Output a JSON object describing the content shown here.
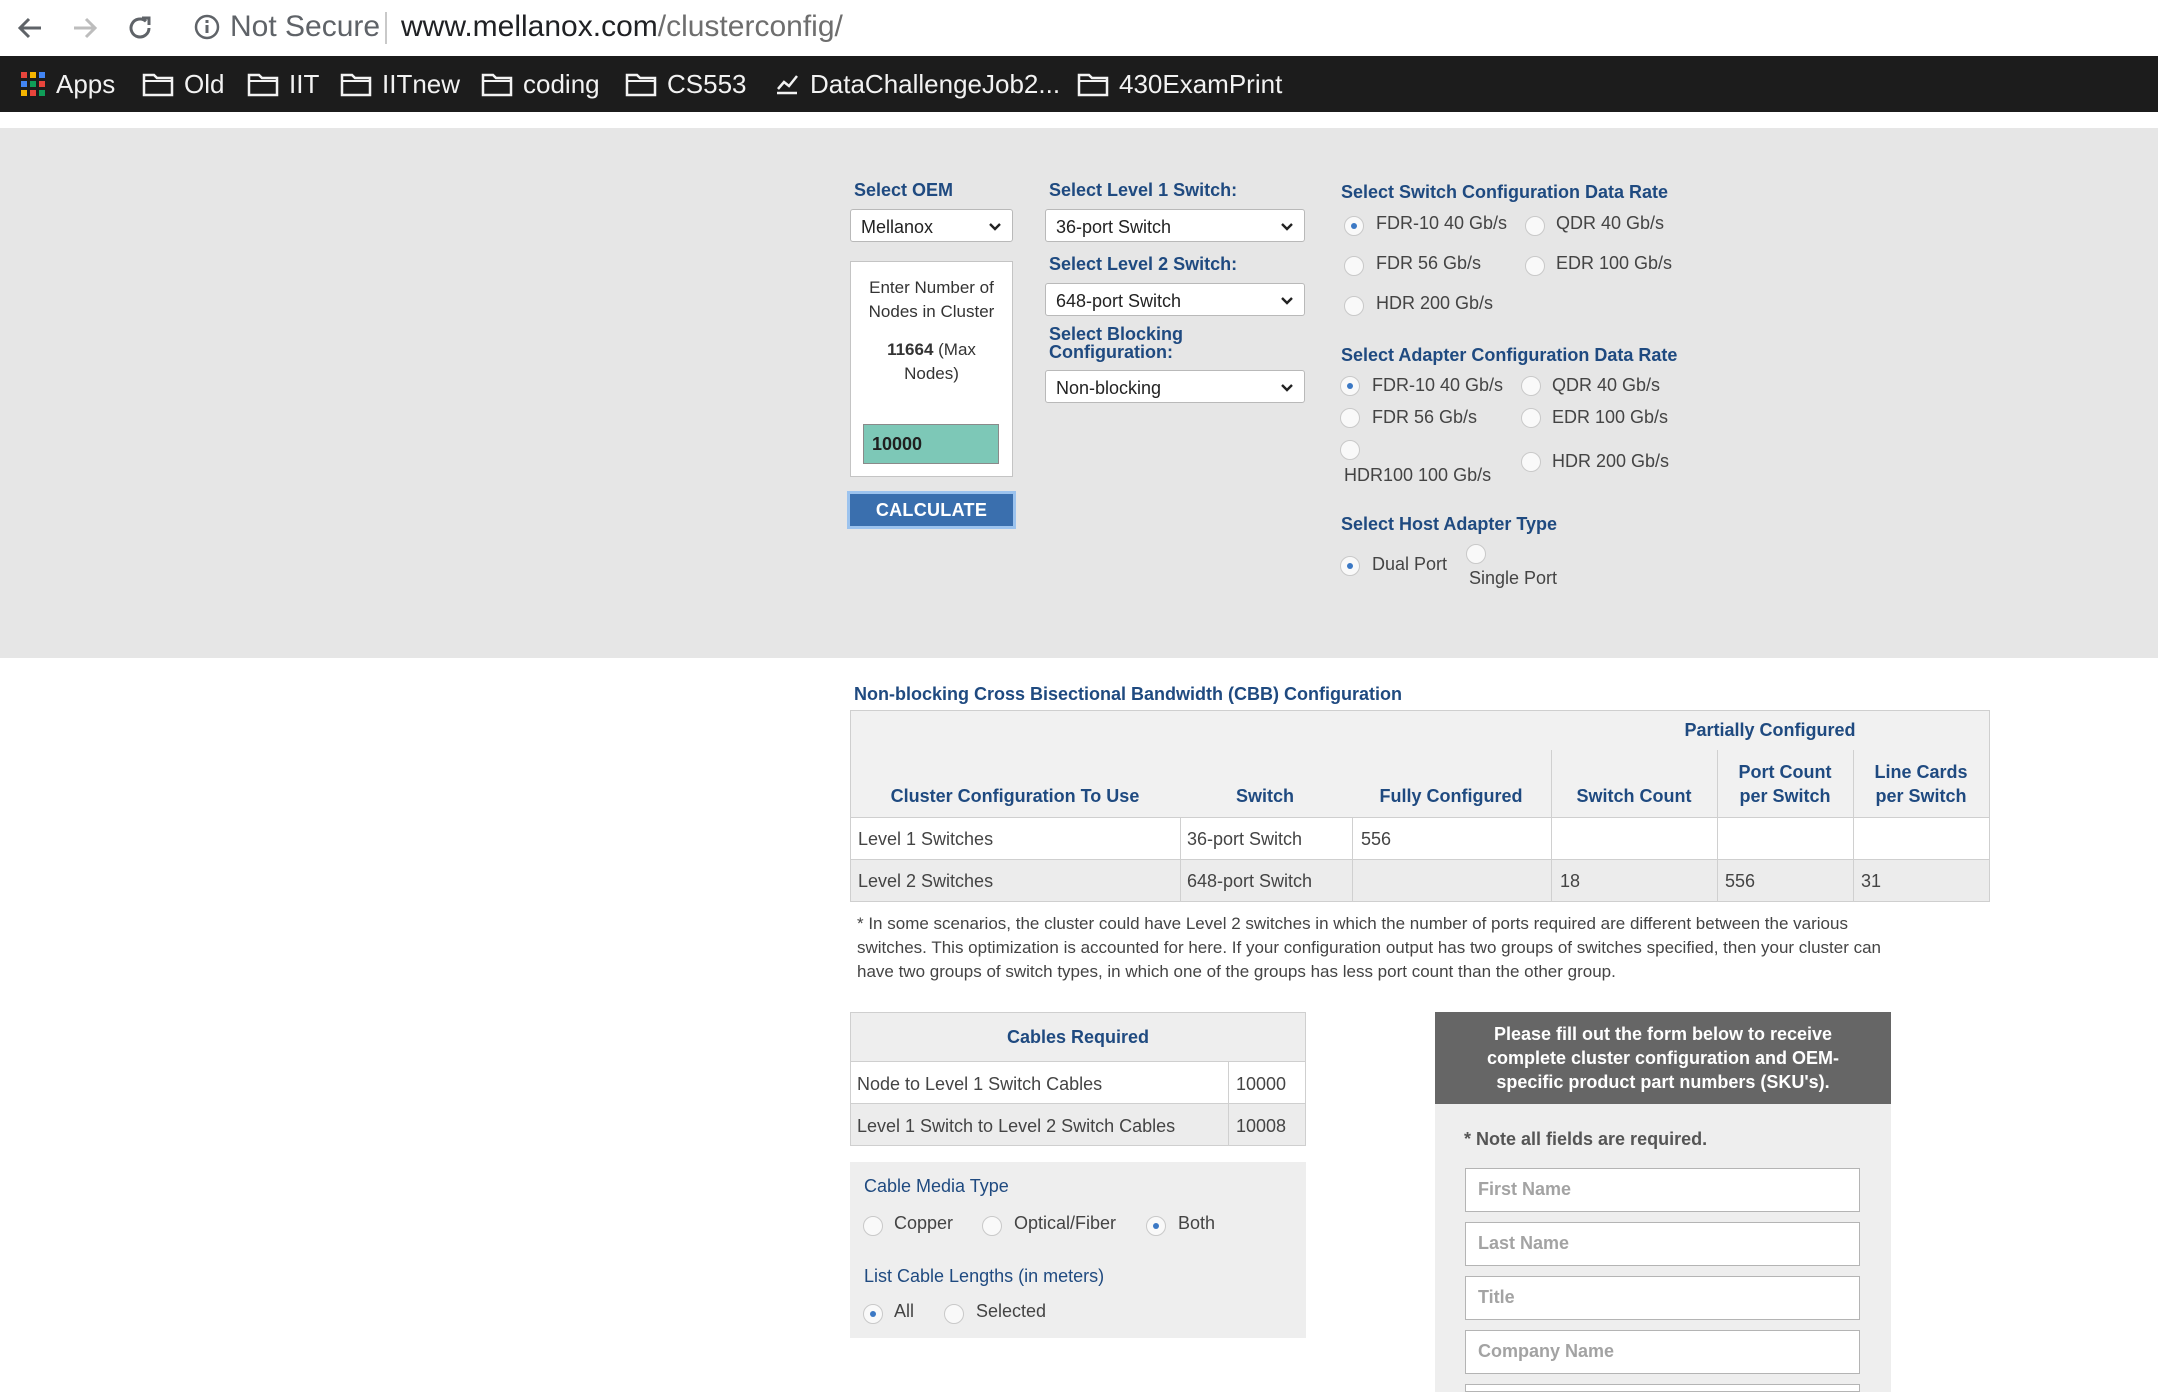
{
  "browser": {
    "security_label": "Not Secure",
    "url_domain": "www.mellanox.com",
    "url_path": "/clusterconfig/",
    "bookmarks": [
      {
        "label": "Apps",
        "icon": "apps-grid-icon"
      },
      {
        "label": "Old",
        "icon": "folder-icon"
      },
      {
        "label": "IIT",
        "icon": "folder-icon"
      },
      {
        "label": "IITnew",
        "icon": "folder-icon"
      },
      {
        "label": "coding",
        "icon": "folder-icon"
      },
      {
        "label": "CS553",
        "icon": "folder-icon"
      },
      {
        "label": "DataChallengeJob2...",
        "icon": "chart-icon"
      },
      {
        "label": "430ExamPrint",
        "icon": "folder-icon"
      }
    ]
  },
  "config": {
    "oem": {
      "label": "Select OEM",
      "value": "Mellanox"
    },
    "nodes": {
      "prompt": "Enter Number of Nodes in Cluster",
      "prompt_line1": "Enter Number of",
      "prompt_line2": "Nodes in Cluster",
      "max_value": "11664",
      "max_suffix": " (Max",
      "max_suffix2": "Nodes)",
      "value": "10000"
    },
    "calculate_label": "CALCULATE",
    "level1": {
      "label": "Select Level 1 Switch:",
      "value": "36-port Switch"
    },
    "level2": {
      "label": "Select Level 2 Switch:",
      "value": "648-port Switch"
    },
    "blocking": {
      "label_line1": "Select Blocking",
      "label_line2": "Configuration:",
      "value": "Non-blocking"
    },
    "switch_rate": {
      "label": "Select Switch Configuration Data Rate",
      "options": [
        "FDR-10 40 Gb/s",
        "QDR 40 Gb/s",
        "FDR 56 Gb/s",
        "EDR 100 Gb/s",
        "HDR 200 Gb/s"
      ],
      "selected": "FDR-10 40 Gb/s"
    },
    "adapter_rate": {
      "label": "Select Adapter Configuration Data Rate",
      "options": [
        "FDR-10 40 Gb/s",
        "QDR 40 Gb/s",
        "FDR 56 Gb/s",
        "EDR 100 Gb/s",
        "HDR100 100 Gb/s",
        "HDR 200 Gb/s"
      ],
      "selected": "FDR-10 40 Gb/s"
    },
    "host_adapter": {
      "label": "Select Host Adapter Type",
      "options": [
        "Dual Port",
        "Single Port"
      ],
      "selected": "Dual Port"
    }
  },
  "results": {
    "title": "Non-blocking Cross Bisectional Bandwidth (CBB) Configuration",
    "partial_header": "Partially Configured",
    "columns": [
      "Cluster Configuration To Use",
      "Switch",
      "Fully Configured",
      "Switch Count",
      "Port Count per Switch",
      "Line Cards per Switch"
    ],
    "col_port_line1": "Port Count",
    "col_port_line2": "per Switch",
    "col_line_line1": "Line Cards",
    "col_line_line2": "per Switch",
    "rows": [
      [
        "Level 1 Switches",
        "36-port Switch",
        "556",
        "",
        "",
        ""
      ],
      [
        "Level 2 Switches",
        "648-port Switch",
        "",
        "18",
        "556",
        "31"
      ]
    ],
    "note_line1": "* In some scenarios, the cluster could have Level 2 switches in which the number of ports required are different between the various",
    "note_line2": "switches. This optimization is accounted for here. If your configuration output has two groups of switches specified, then your cluster can",
    "note_line3": "have two groups of switch types, in which one of the groups has less port count than the other group."
  },
  "cables": {
    "header": "Cables Required",
    "rows": [
      [
        "Node to Level 1 Switch Cables",
        "10000"
      ],
      [
        "Level 1 Switch to Level 2 Switch Cables",
        "10008"
      ]
    ],
    "media_label": "Cable Media Type",
    "media_options": [
      "Copper",
      "Optical/Fiber",
      "Both"
    ],
    "media_selected": "Both",
    "lengths_label": "List Cable Lengths (in meters)",
    "length_options": [
      "All",
      "Selected"
    ],
    "length_selected": "All"
  },
  "form": {
    "header_line1": "Please fill out the form below to receive",
    "header_line2": "complete cluster configuration and OEM-",
    "header_line3": "specific product part numbers (SKU's).",
    "note": "* Note all fields are required.",
    "fields": [
      "First Name",
      "Last Name",
      "Title",
      "Company Name"
    ]
  },
  "colors": {
    "accent_blue": "#1f4a80",
    "button_blue": "#3a6fae",
    "nodes_input_green": "#7dc8b7",
    "panel_gray": "#e6e6e6",
    "form_header_gray": "#666666"
  }
}
